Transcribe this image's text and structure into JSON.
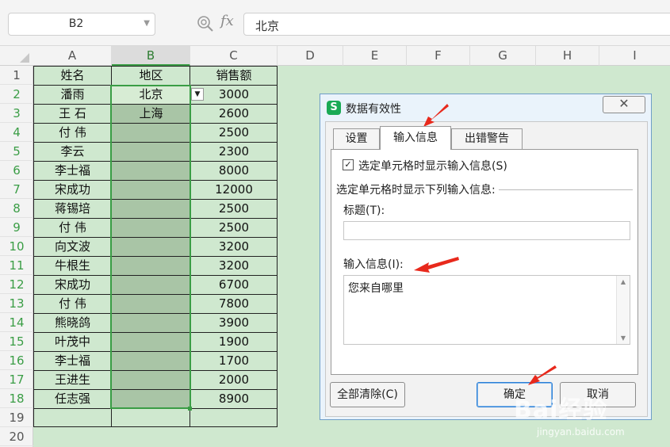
{
  "formula_bar": {
    "cell_ref": "B2",
    "zoom_icon": "magnifier-icon",
    "fx_label": "fx",
    "formula_value": "北京"
  },
  "columns": [
    "A",
    "B",
    "C",
    "D",
    "E",
    "F",
    "G",
    "H",
    "I"
  ],
  "rows": [
    "1",
    "2",
    "3",
    "4",
    "5",
    "6",
    "7",
    "8",
    "9",
    "10",
    "11",
    "12",
    "13",
    "14",
    "15",
    "16",
    "17",
    "18",
    "19",
    "20"
  ],
  "table": {
    "headers": [
      "姓名",
      "地区",
      "销售额"
    ],
    "data": [
      {
        "name": "潘雨",
        "region": "北京",
        "sales": "3000"
      },
      {
        "name": "王  石",
        "region": "上海",
        "sales": "2600"
      },
      {
        "name": "付  伟",
        "region": "",
        "sales": "2500"
      },
      {
        "name": "李云",
        "region": "",
        "sales": "2300"
      },
      {
        "name": "李士福",
        "region": "",
        "sales": "8000"
      },
      {
        "name": "宋成功",
        "region": "",
        "sales": "12000"
      },
      {
        "name": "蒋锡培",
        "region": "",
        "sales": "2500"
      },
      {
        "name": "付  伟",
        "region": "",
        "sales": "2500"
      },
      {
        "name": "向文波",
        "region": "",
        "sales": "3200"
      },
      {
        "name": "牛根生",
        "region": "",
        "sales": "3200"
      },
      {
        "name": "宋成功",
        "region": "",
        "sales": "6700"
      },
      {
        "name": "付  伟",
        "region": "",
        "sales": "7800"
      },
      {
        "name": "熊晓鸽",
        "region": "",
        "sales": "3900"
      },
      {
        "name": "叶茂中",
        "region": "",
        "sales": "1900"
      },
      {
        "name": "李士福",
        "region": "",
        "sales": "1700"
      },
      {
        "name": "王进生",
        "region": "",
        "sales": "2000"
      },
      {
        "name": "任志强",
        "region": "",
        "sales": "8900"
      }
    ]
  },
  "dialog": {
    "logo": "S",
    "title": "数据有效性",
    "close_glyph": "✕",
    "tabs": [
      "设置",
      "输入信息",
      "出错警告"
    ],
    "active_tab": "输入信息",
    "show_input_checkbox": {
      "checked": true,
      "glyph": "✓",
      "label": "选定单元格时显示输入信息(S)"
    },
    "group_label": "选定单元格时显示下列输入信息:",
    "title_field": {
      "label": "标题(T):",
      "value": ""
    },
    "message_field": {
      "label": "输入信息(I):",
      "value": "您来自哪里"
    },
    "buttons": {
      "clear_all": "全部清除(C)",
      "ok": "确定",
      "cancel": "取消"
    }
  },
  "colors": {
    "sheet_bg": "#cfe8cf",
    "selection_border": "#3a9d45",
    "arrow": "#e8291c"
  },
  "watermark": {
    "main": "Bai经验",
    "sub": "jingyan.baidu.com"
  }
}
